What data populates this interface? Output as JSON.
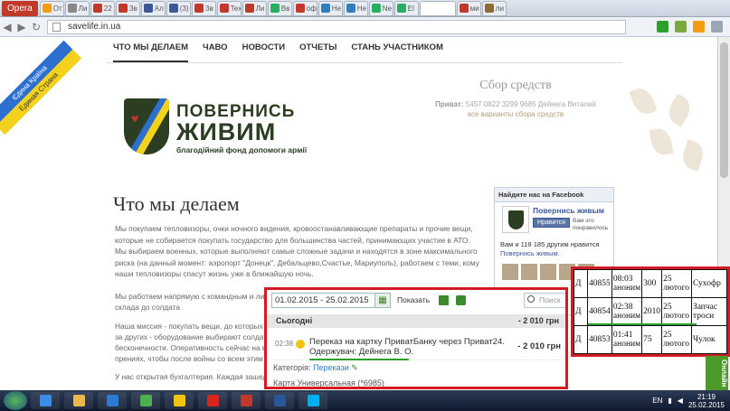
{
  "browser": {
    "menu_label": "Opera",
    "tabs": [
      {
        "label": "От",
        "color": "#f39c12"
      },
      {
        "label": "Ли",
        "color": "#888"
      },
      {
        "label": "22",
        "color": "#c0392b"
      },
      {
        "label": "Зв",
        "color": "#c0392b"
      },
      {
        "label": "Ал",
        "color": "#3b5998"
      },
      {
        "label": "(3)",
        "color": "#3b5998"
      },
      {
        "label": "Зв",
        "color": "#c0392b"
      },
      {
        "label": "Tex",
        "color": "#c0392b"
      },
      {
        "label": "Ли",
        "color": "#c0392b"
      },
      {
        "label": "Вв",
        "color": "#27ae60"
      },
      {
        "label": "оф",
        "color": "#c0392b"
      },
      {
        "label": "Не",
        "color": "#2f7ebd"
      },
      {
        "label": "He",
        "color": "#2f7ebd"
      },
      {
        "label": "Ne",
        "color": "#27ae60"
      },
      {
        "label": "El",
        "color": "#27ae60"
      },
      {
        "label": "",
        "color": "#ffffff",
        "active": true
      },
      {
        "label": "ми",
        "color": "#c0392b"
      },
      {
        "label": "ли",
        "color": "#8e6b2f"
      }
    ],
    "url": "savelife.in.ua"
  },
  "site": {
    "ribbon": {
      "line1": "Єдина Країна",
      "line2": "Единая Страна"
    },
    "menu": [
      "ЧТО МЫ ДЕЛАЕМ",
      "ЧАВО",
      "НОВОСТИ",
      "ОТЧЕТЫ",
      "СТАНЬ УЧАСТНИКОМ"
    ],
    "logo": {
      "line1": "ПОВЕРНИСЬ",
      "line2": "ЖИВИМ",
      "line3": "благодійний фонд допомоги армії"
    },
    "collect": {
      "title": "Сбор средств",
      "privat_label": "Приват:",
      "privat_value": "5457 0822 3299 9685 Дейнега Виталий",
      "link": "все варианты сбора средств"
    },
    "page_title": "Что мы делаем",
    "paragraphs": [
      "Мы покупаем тепловизоры, очки ночного видения, кровоостанавливающие препараты и прочие вещи, которые не собирается покупать государство для большинства частей, принимающих участие в АТО. Мы выбираем военных, которые выполняют самые сложные задачи и находятся в зоне максимального риска (на данный момент: аэропорт \"Донецк\", Дебальцево,Счастье, Мариуполь), работаем с теми, кому наши тепловизоры спасут жизнь уже в ближайшую ночь.",
      "Мы работаем напрямую с командным и личным составом, ...",
      "склада до солдата",
      "Наша миссия - покупать вещи, до которых гос...",
      "за других - оборудование выбирают солдаты, ...",
      "бесконечности. Оперативность сейчас на вес ...",
      "прениях, чтобы после войны со всем этим ...",
      "У нас открытая бухгалтерия. Каждая зашедш..."
    ],
    "facebook": {
      "header": "Найдите нас на Facebook",
      "page_name": "Повернись живым",
      "like_label": "Нравится",
      "likes_text": "Вам это понравилось",
      "count_text": "Вам и 118 185 другим нравится",
      "count_link": "Повернись живым."
    }
  },
  "payment": {
    "date_range": "01.02.2015 - 25.02.2015",
    "show_label": "Показать",
    "search_placeholder": "Поиск",
    "today_label": "Сьогодні",
    "today_amount": "- 2 010",
    "currency": "грн",
    "entry": {
      "time": "02:38",
      "description": "Переказ на картку ПриватБанку через Приват24. Одержувач: Дейнега В. О.",
      "amount": "- 2 010",
      "currency": "грн"
    },
    "category_label": "Категорія:",
    "category_value": "Перекази",
    "card": "Карта Универсальная (*6985)"
  },
  "ledger": {
    "rows": [
      [
        "Д",
        "40855",
        "08:03 аноним",
        "300",
        "25 лютого",
        "Сухофр"
      ],
      [
        "Д",
        "40854",
        "02:38 аноним",
        "2010",
        "25 лютого",
        "Запчас троси"
      ],
      [
        "Д",
        "40853",
        "01:41 аноним",
        "75",
        "25 лютого",
        "Чулок"
      ]
    ]
  },
  "side_tab": "Онлайн",
  "taskbar": {
    "apps": [
      {
        "name": "ie",
        "color": "#3a8ee6"
      },
      {
        "name": "explorer",
        "color": "#e8b84a"
      },
      {
        "name": "media",
        "color": "#2a7bd5"
      },
      {
        "name": "chrome",
        "color": "#4caf50"
      },
      {
        "name": "aimp",
        "color": "#f1c40f"
      },
      {
        "name": "yandex",
        "color": "#d9261c"
      },
      {
        "name": "opera",
        "color": "#c0392b"
      },
      {
        "name": "word",
        "color": "#2b579a"
      },
      {
        "name": "skype",
        "color": "#00aff0"
      }
    ],
    "lang": "EN",
    "time": "21:19",
    "date": "25.02.2015"
  }
}
